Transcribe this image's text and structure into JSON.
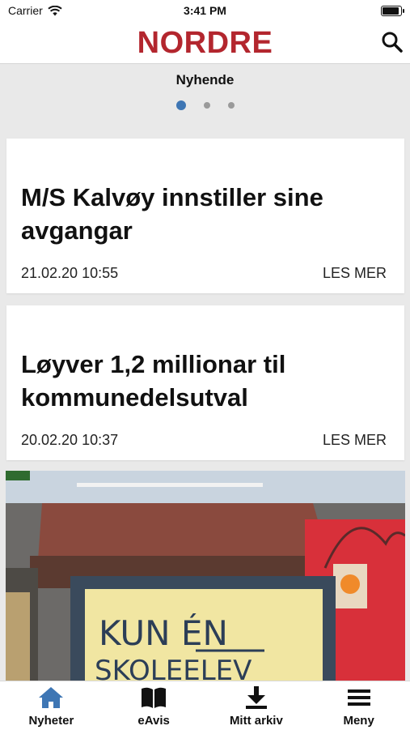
{
  "status_bar": {
    "carrier": "Carrier",
    "time": "3:41 PM"
  },
  "header": {
    "logo": "NORDRE",
    "search_icon": "search-icon"
  },
  "section": {
    "title": "Nyhende",
    "page_count": 3,
    "active_page": 1
  },
  "articles": [
    {
      "headline": "M/S Kalvøy innstiller sine avgangar",
      "date": "21.02.20 10:55",
      "more_label": "LES MER"
    },
    {
      "headline": "Løyver 1,2 millionar til kommunedelsutval",
      "date": "20.02.20 10:37",
      "more_label": "LES MER"
    }
  ],
  "photo": {
    "sign_text_line1": "KUN ÉN",
    "sign_text_line2": "SKOLEELEV"
  },
  "tabbar": {
    "tabs": [
      {
        "label": "Nyheter",
        "icon": "home-icon",
        "active": true
      },
      {
        "label": "eAvis",
        "icon": "book-icon",
        "active": false
      },
      {
        "label": "Mitt arkiv",
        "icon": "download-icon",
        "active": false
      },
      {
        "label": "Meny",
        "icon": "menu-icon",
        "active": false
      }
    ]
  },
  "colors": {
    "brand": "#b3262e",
    "accent": "#3e76b4",
    "background": "#e9e9e9"
  }
}
